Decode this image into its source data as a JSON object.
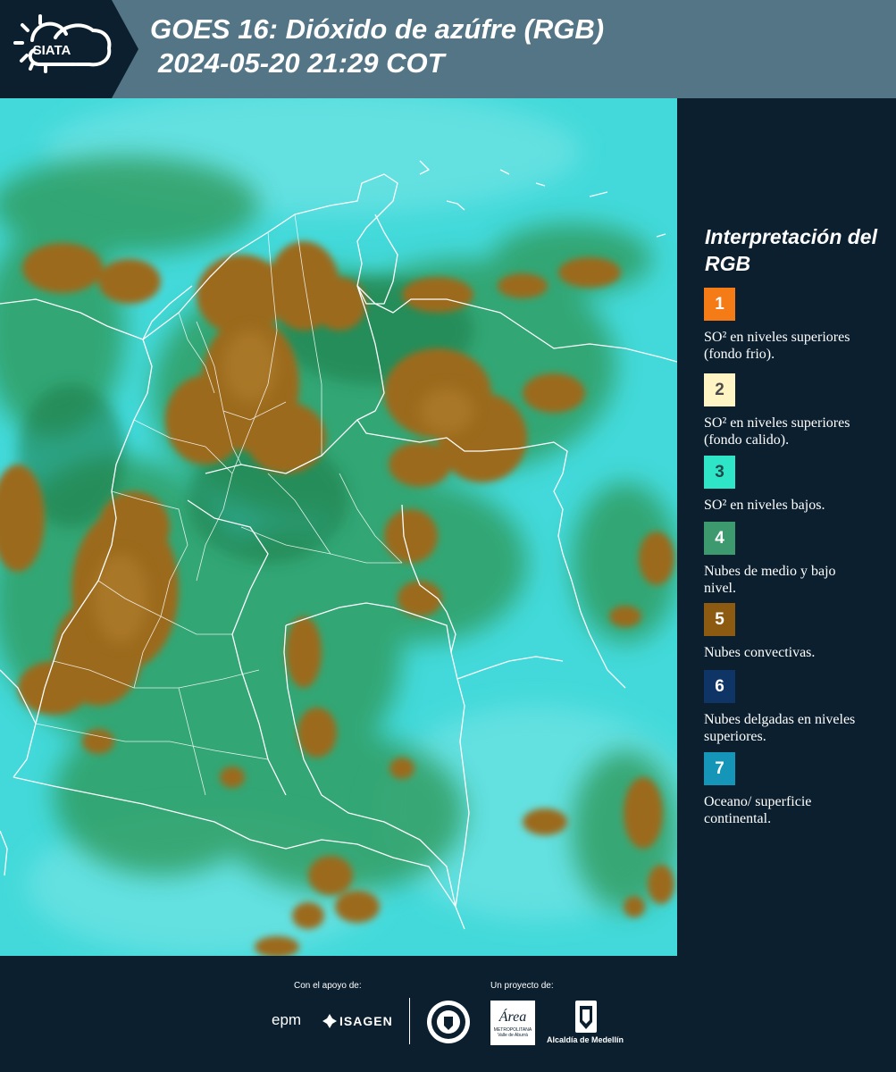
{
  "header": {
    "logo_text": "SIATA",
    "title_line1": "GOES 16: Dióxido de azúfre (RGB)",
    "title_line2": "2024-05-20 21:29 COT"
  },
  "legend": {
    "title": "Interpretación del RGB",
    "items": [
      {
        "number": "1",
        "label": "SO² en niveles superiores (fondo frio).",
        "color": "#f47b16",
        "text_color": "#ffffff"
      },
      {
        "number": "2",
        "label": "SO² en niveles superiores (fondo calido).",
        "color": "#fff5c4",
        "text_color": "#4a4a4a"
      },
      {
        "number": "3",
        "label": "SO² en niveles bajos.",
        "color": "#2fe5c8",
        "text_color": "#1f4a4a"
      },
      {
        "number": "4",
        "label": "Nubes de medio y bajo nivel.",
        "color": "#3d9a6f",
        "text_color": "#ffffff"
      },
      {
        "number": "5",
        "label": "Nubes convectivas.",
        "color": "#8d5a12",
        "text_color": "#ffffff"
      },
      {
        "number": "6",
        "label": "Nubes delgadas en niveles superiores.",
        "color": "#0f3466",
        "text_color": "#ffffff"
      },
      {
        "number": "7",
        "label": "Oceano/ superficie continental.",
        "color": "#1596b8",
        "text_color": "#ffffff"
      }
    ]
  },
  "footer": {
    "support_label": "Con el apoyo de:",
    "project_label": "Un proyecto de:",
    "epm_logo": "epm",
    "isagen_logo": "ISAGEN",
    "area_logo": "Área",
    "area_sub": "METROPOLITANA",
    "area_sub2": "Valle de Aburrá",
    "alcaldia_logo": "Alcaldía de Medellín"
  }
}
